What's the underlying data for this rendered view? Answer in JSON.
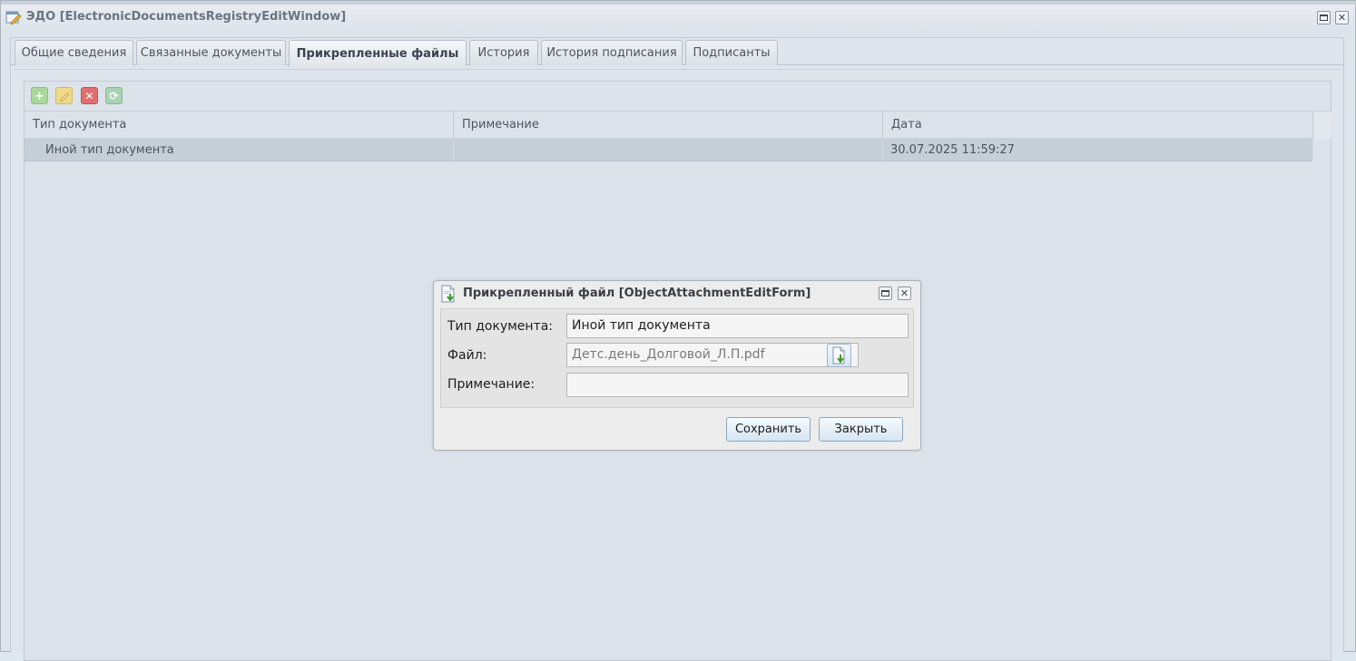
{
  "main_window": {
    "title": "ЭДО [ElectronicDocumentsRegistryEditWindow]"
  },
  "tabs": [
    {
      "label": "Общие сведения",
      "active": false
    },
    {
      "label": "Связанные документы",
      "active": false
    },
    {
      "label": "Прикрепленные файлы",
      "active": true
    },
    {
      "label": "История",
      "active": false
    },
    {
      "label": "История подписания",
      "active": false
    },
    {
      "label": "Подписанты",
      "active": false
    }
  ],
  "toolbar": {
    "add_icon": "plus-icon",
    "edit_icon": "pencil-icon",
    "delete_icon": "delete-icon",
    "refresh_icon": "refresh-icon"
  },
  "grid": {
    "columns": [
      "Тип документа",
      "Примечание",
      "Дата"
    ],
    "rows": [
      {
        "doc_type": "Иной тип документа",
        "note": "",
        "date": "30.07.2025 11:59:27"
      }
    ]
  },
  "modal": {
    "title": "Прикрепленный файл [ObjectAttachmentEditForm]",
    "fields": {
      "doc_type_label": "Тип документа:",
      "doc_type_value": "Иной тип документа",
      "file_label": "Файл:",
      "file_value": "Детс.день_Долговой_Л.П.pdf",
      "note_label": "Примечание:",
      "note_value": ""
    },
    "save_label": "Сохранить",
    "close_label": "Закрыть"
  },
  "colors": {
    "window_bg": "#dee4eb",
    "selected_row": "#c6ced8",
    "modal_bg": "#ececec",
    "button_border": "#8ea7bf"
  }
}
